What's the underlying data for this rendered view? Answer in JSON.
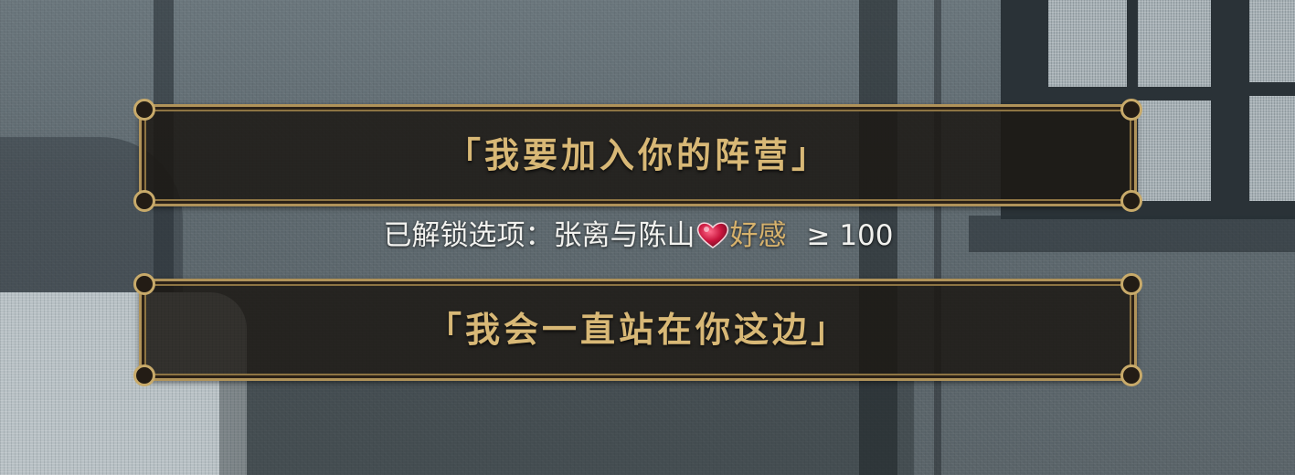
{
  "choices": [
    {
      "label": "「我要加入你的阵营」"
    },
    {
      "label": "「我会一直站在你这边」"
    }
  ],
  "unlock_hint": {
    "prefix": "已解锁选项：",
    "character": "张离与陈山",
    "icon": "heart-icon",
    "stat": "好感",
    "condition": "≥ 100"
  },
  "colors": {
    "choice_text": "#d8b876",
    "frame_gold": "#b0935a",
    "stat_text": "#d6b16c",
    "heart": "#c8143c"
  }
}
